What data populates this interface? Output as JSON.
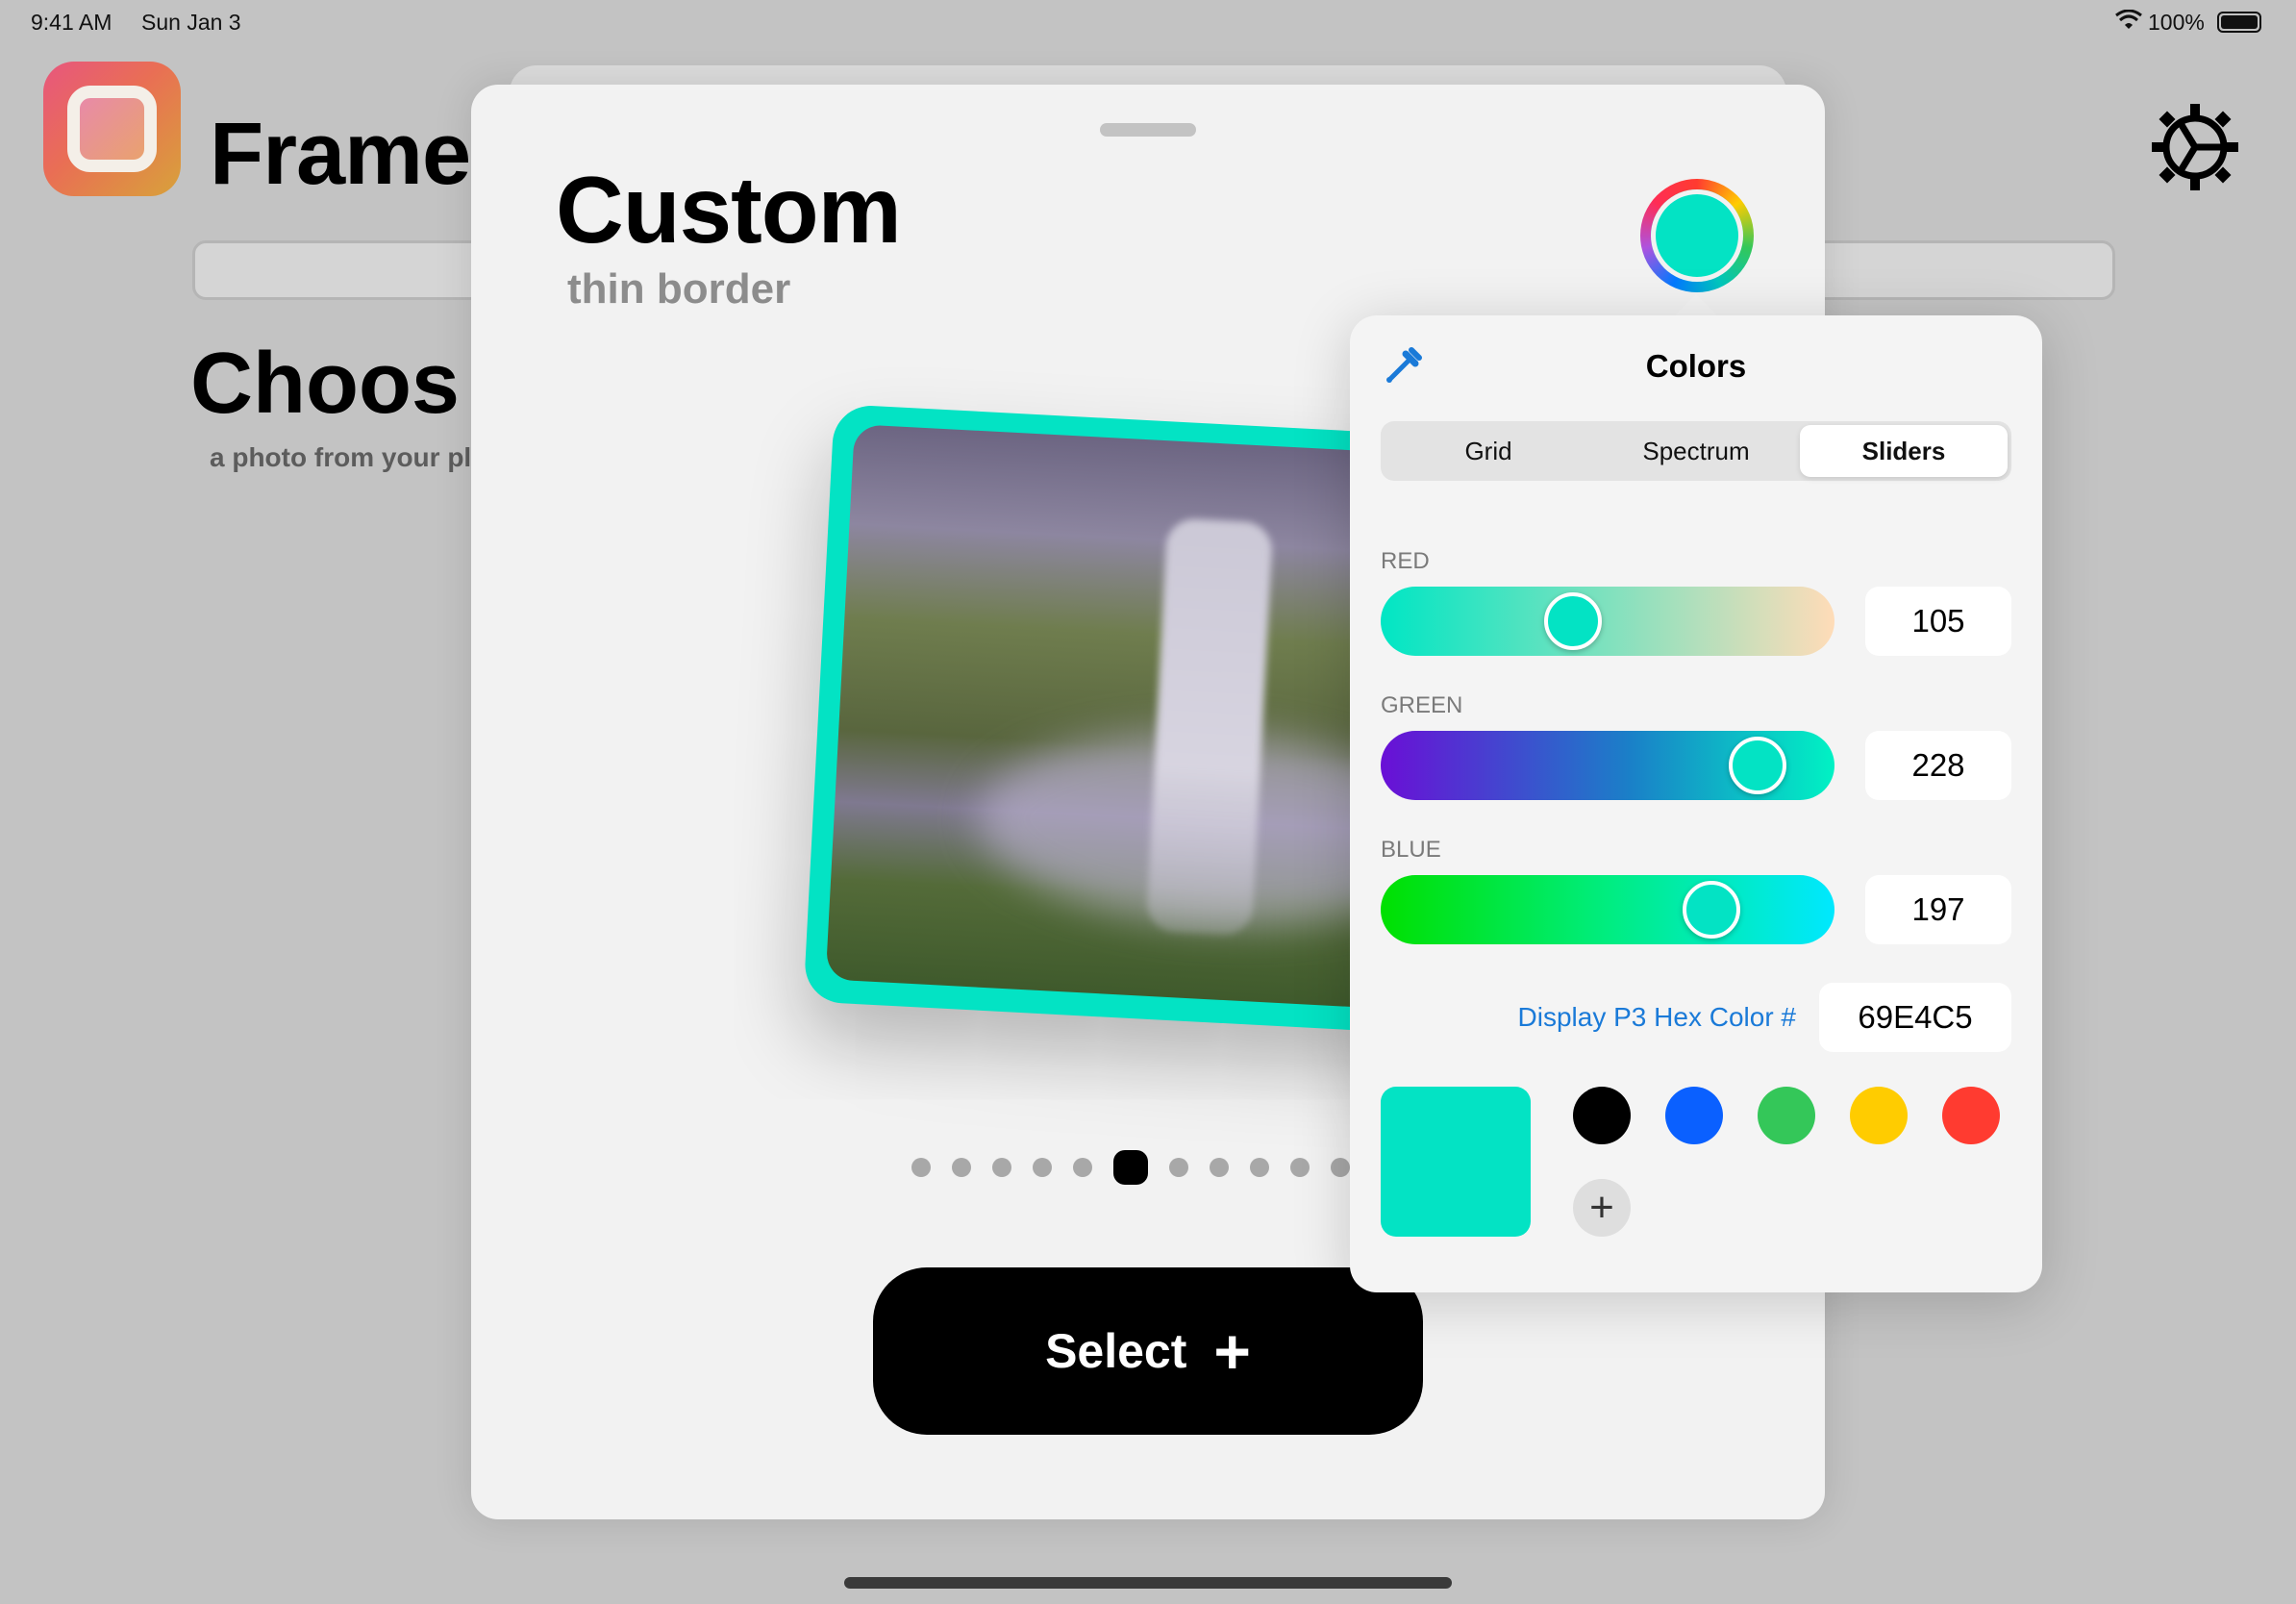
{
  "status_bar": {
    "time": "9:41 AM",
    "date": "Sun Jan 3",
    "battery": "100%"
  },
  "background_app": {
    "title": "Frame",
    "heading": "Choos",
    "subheading": "a photo from your pl"
  },
  "sheet": {
    "title": "Custom",
    "subtitle": "thin border",
    "page_count": 11,
    "current_page": 6,
    "select_label": "Select",
    "select_icon": "+"
  },
  "color_picker": {
    "title": "Colors",
    "tabs": [
      {
        "label": "Grid",
        "selected": false
      },
      {
        "label": "Spectrum",
        "selected": false
      },
      {
        "label": "Sliders",
        "selected": true
      }
    ],
    "sliders": {
      "red": {
        "label": "RED",
        "value": "105",
        "fraction": 0.41
      },
      "green": {
        "label": "GREEN",
        "value": "228",
        "fraction": 0.89
      },
      "blue": {
        "label": "BLUE",
        "value": "197",
        "fraction": 0.77
      }
    },
    "hex_label": "Display P3 Hex Color #",
    "hex_value": "69E4C5",
    "current_color": "#03E3C4",
    "swatches": [
      "#000000",
      "#0a60ff",
      "#34c759",
      "#ffcc00",
      "#ff3b30"
    ],
    "add_label": "+"
  }
}
